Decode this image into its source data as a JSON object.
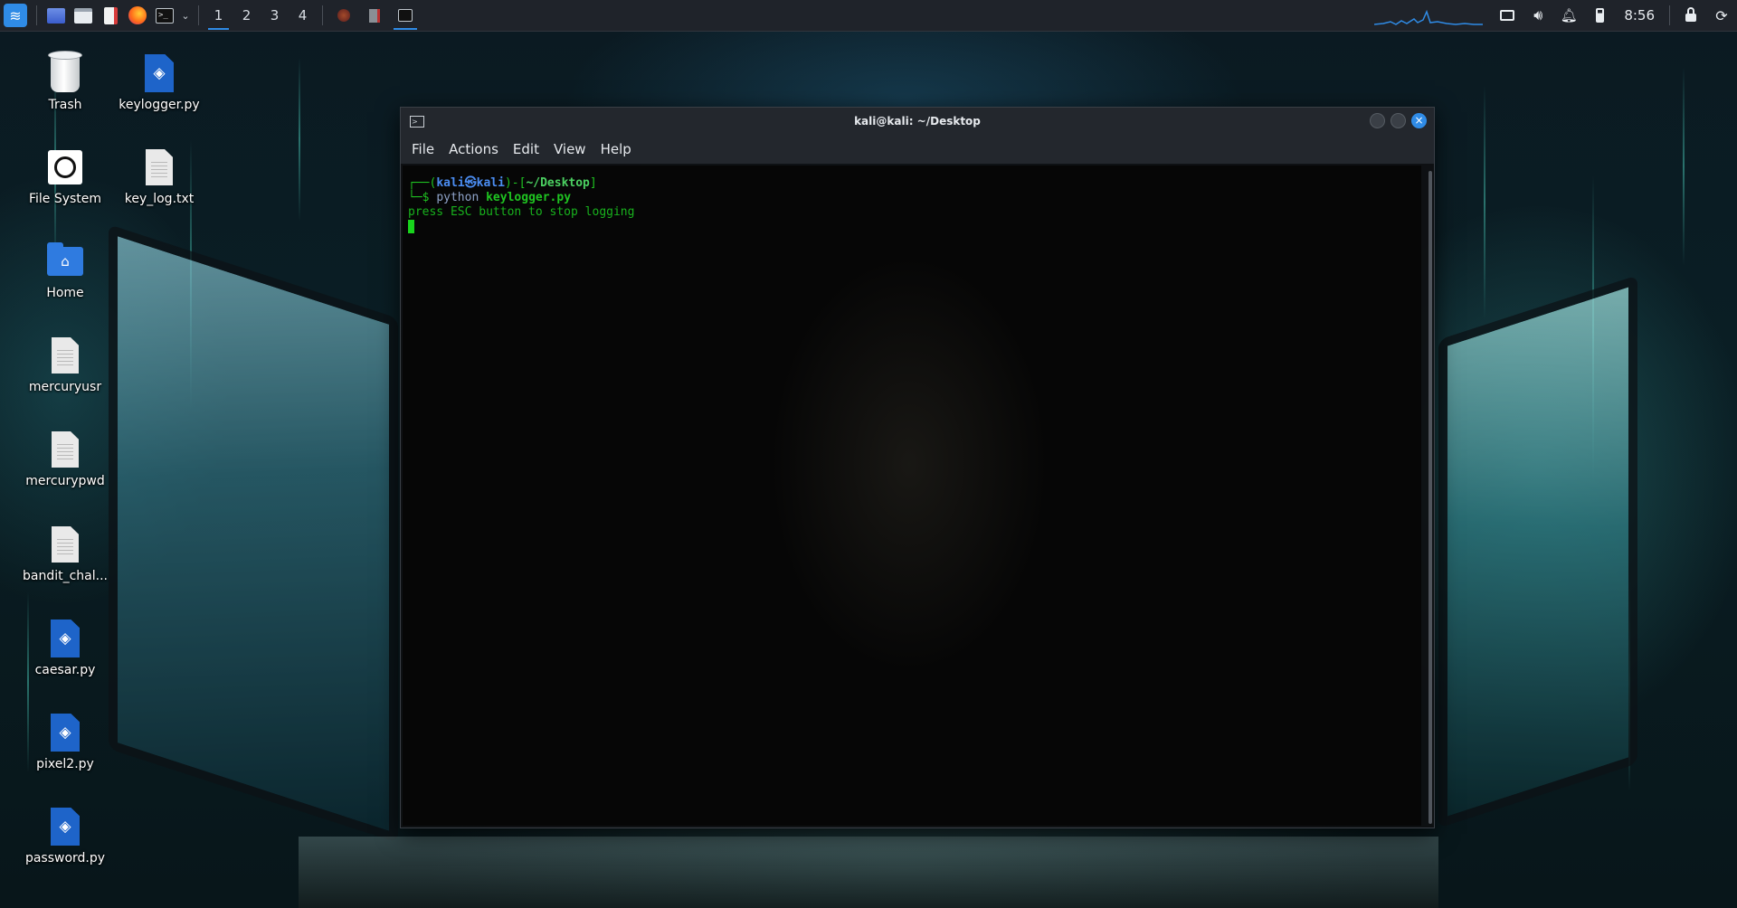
{
  "taskbar": {
    "workspaces": [
      "1",
      "2",
      "3",
      "4"
    ],
    "active_workspace": "1",
    "clock": "8:56",
    "apps": [
      "kali-menu-icon",
      "show-desktop-icon",
      "file-manager-icon",
      "text-editor-icon",
      "firefox-icon",
      "terminal-icon"
    ],
    "tray": [
      "screen-icon",
      "volume-icon",
      "notification-bell-icon",
      "battery-icon",
      "lock-icon",
      "power-icon"
    ]
  },
  "desktop": {
    "icons": [
      {
        "label": "Trash"
      },
      {
        "label": "keylogger.py"
      },
      {
        "label": "File System"
      },
      {
        "label": "key_log.txt"
      },
      {
        "label": "Home"
      },
      {
        "label": "mercuryusr"
      },
      {
        "label": "mercurypwd"
      },
      {
        "label": "bandit_chal..."
      },
      {
        "label": "caesar.py"
      },
      {
        "label": "pixel2.py"
      },
      {
        "label": "password.py"
      }
    ]
  },
  "window": {
    "title": "kali@kali: ~/Desktop",
    "menu": [
      "File",
      "Actions",
      "Edit",
      "View",
      "Help"
    ],
    "terminal": {
      "prompt_open": "┌──(",
      "user": "kali",
      "at": "㉿",
      "host": "kali",
      "prompt_mid": ")-[",
      "path": "~/Desktop",
      "prompt_close": "]",
      "prompt_line2": "└─$ ",
      "command": "python",
      "argument": "keylogger.py",
      "output": "press ESC button to stop logging"
    }
  },
  "colors": {
    "accent": "#2f8be6",
    "terminal_green": "#1fc421",
    "terminal_blue": "#4b8df2"
  }
}
